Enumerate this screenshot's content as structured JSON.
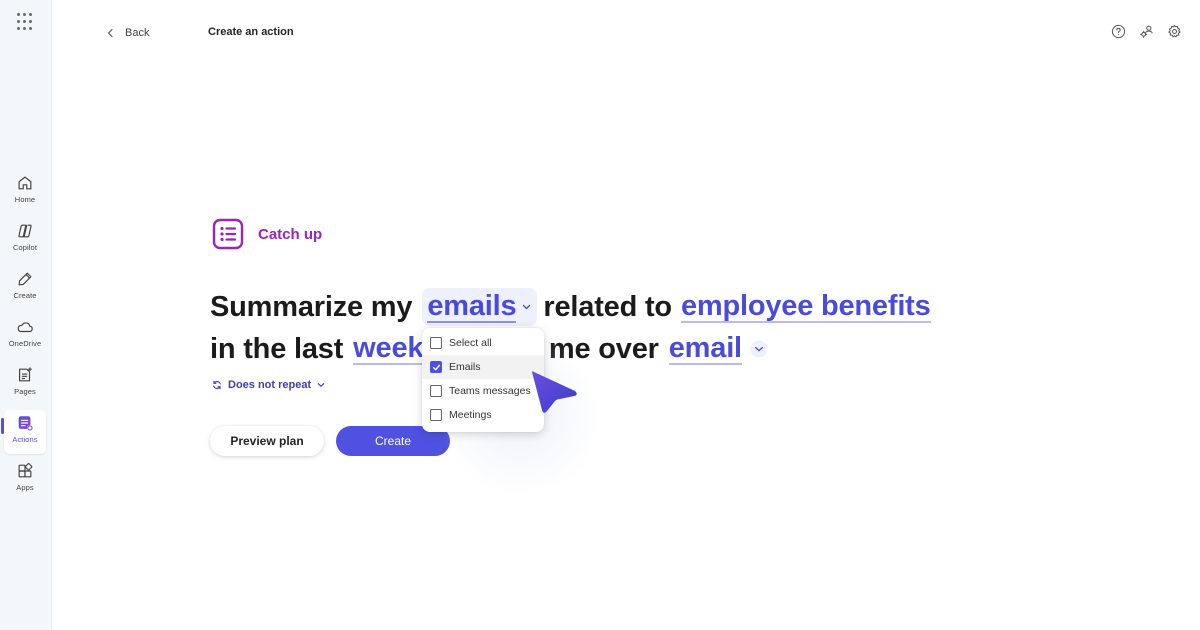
{
  "nav": {
    "apps_launcher_icon": "waffle-icon",
    "items": [
      {
        "label": "Home",
        "icon": "home-icon"
      },
      {
        "label": "Copilot",
        "icon": "copilot-icon"
      },
      {
        "label": "Create",
        "icon": "pen-icon"
      },
      {
        "label": "OneDrive",
        "icon": "cloud-icon"
      },
      {
        "label": "Pages",
        "icon": "pages-icon"
      },
      {
        "label": "Actions",
        "icon": "actions-icon",
        "active": true
      },
      {
        "label": "Apps",
        "icon": "apps-icon"
      }
    ]
  },
  "header": {
    "back_label": "Back",
    "title": "Create an action",
    "icons": [
      "help-icon",
      "people-settings-icon",
      "settings-icon"
    ]
  },
  "action": {
    "category": "Catch up",
    "category_color": "#9b25b8",
    "sentence": {
      "part1": "Summarize my",
      "source": "emails",
      "part2": "related to",
      "topic": "employee benefits",
      "part3": "in the last",
      "period": "week",
      "part4": "notify me over",
      "channel": "email"
    },
    "repeat": "Does not repeat"
  },
  "dropdown": {
    "options": [
      {
        "label": "Select all",
        "checked": false
      },
      {
        "label": "Emails",
        "checked": true
      },
      {
        "label": "Teams messages",
        "checked": false
      },
      {
        "label": "Meetings",
        "checked": false
      }
    ]
  },
  "buttons": {
    "preview": "Preview plan",
    "create": "Create"
  },
  "colors": {
    "accent": "#4f52e0",
    "token": "#4a4bd8"
  }
}
